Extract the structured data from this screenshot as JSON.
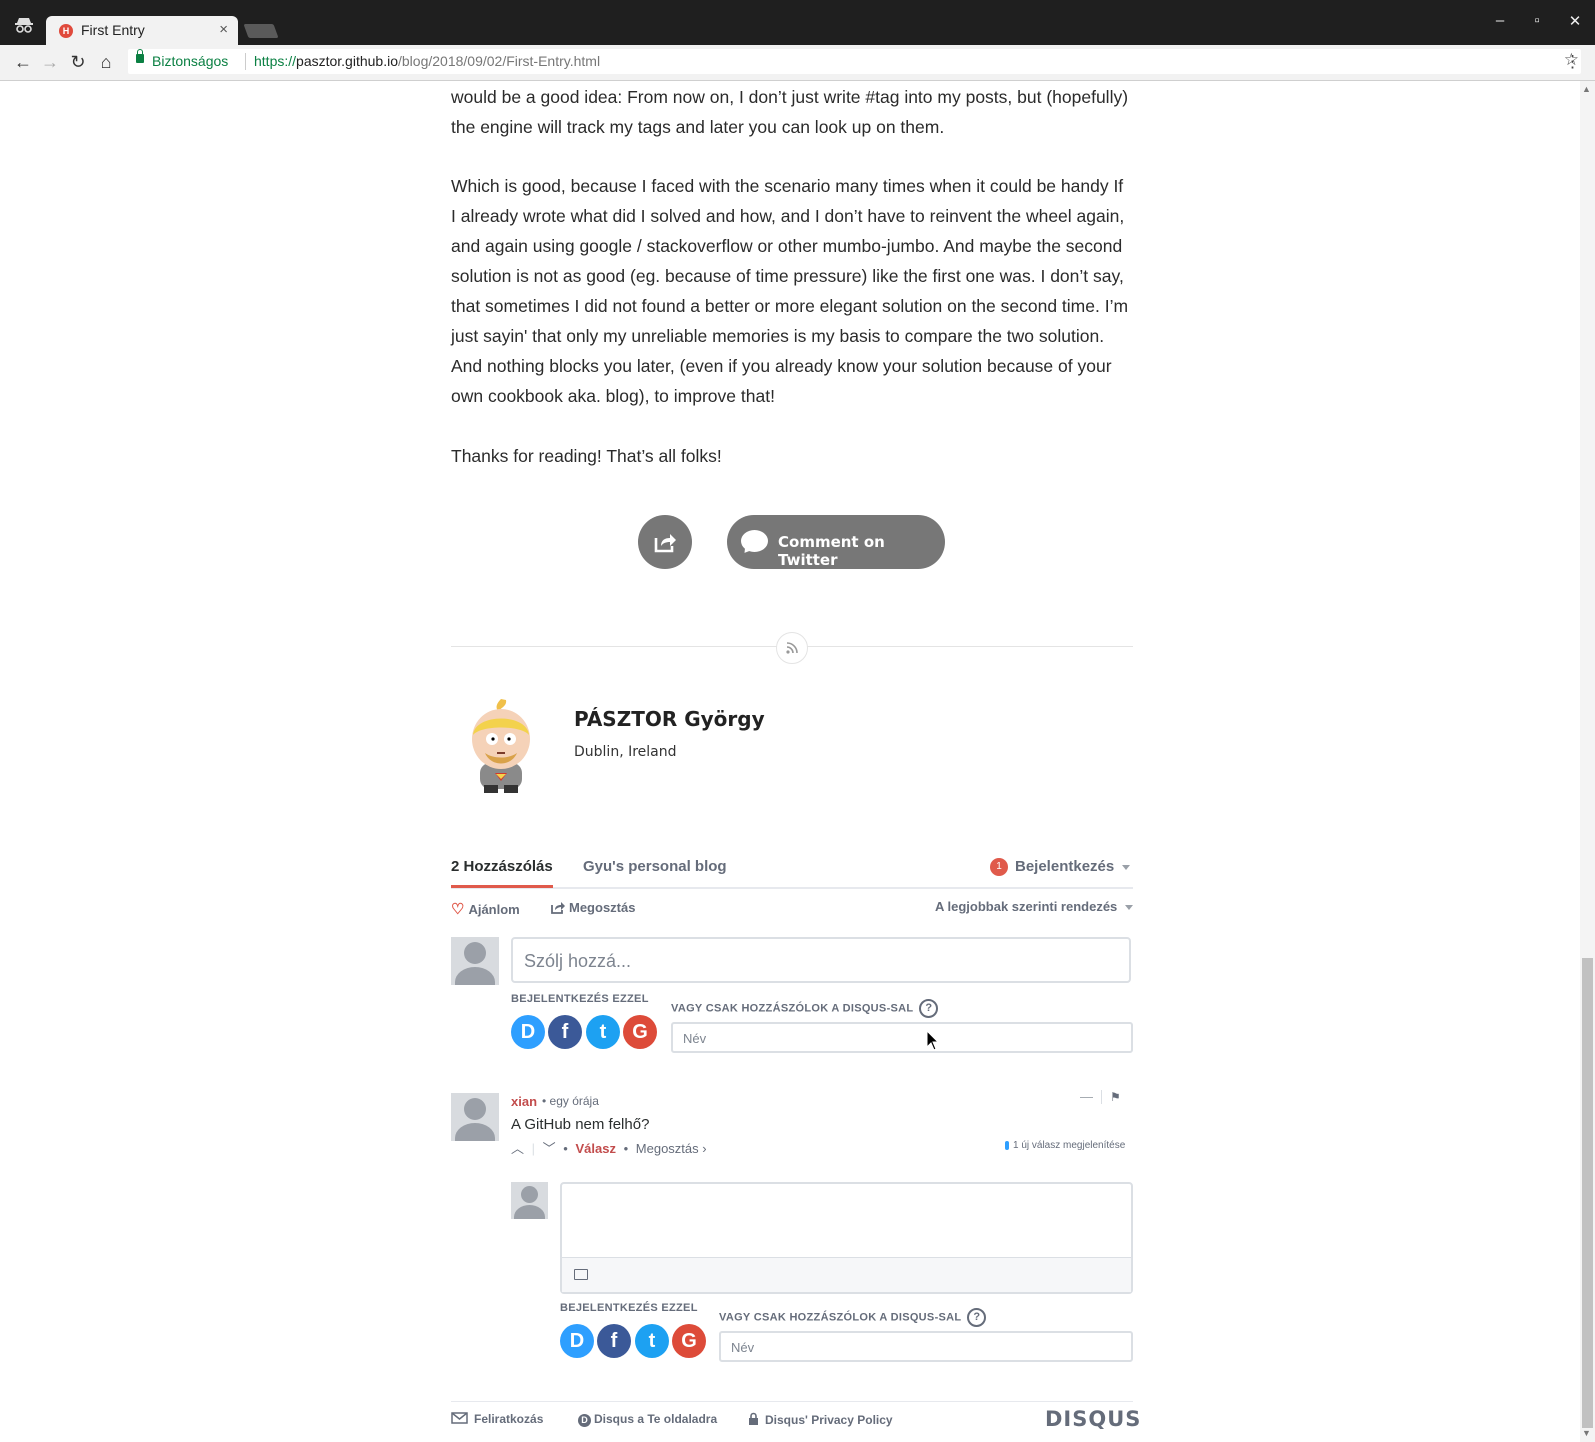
{
  "browser": {
    "tab_title": "First Entry",
    "tab_close": "×",
    "secure_label": "Biztonságos",
    "url_scheme": "https://",
    "url_host": "pasztor.github.io",
    "url_path": "/blog/2018/09/02/First-Entry.html"
  },
  "article": {
    "para1": "would be a good idea: From now on, I don’t just write #tag into my posts, but (hopefully) the engine will track my tags and later you can look up on them.",
    "para2": "Which is good, because I faced with the scenario many times when it could be handy If I already wrote what did I solved and how, and I don’t have to reinvent the wheel again, and again using google / stackoverflow or other mumbo-jumbo. And maybe the second solution is not as good (eg. because of time pressure) like the first one was. I don’t say, that sometimes I did not found a better or more elegant solution on the second time. I’m just sayin' that only my unreliable memories is my basis to compare the two solution. And nothing blocks you later, (even if you already know your solution because of your own cookbook aka. blog), to improve that!",
    "para3": "Thanks for reading! That’s all folks!",
    "twitter_label": "Comment on Twitter"
  },
  "author": {
    "name": "PÁSZTOR György",
    "location": "Dublin, Ireland"
  },
  "disqus": {
    "tab_comments": "2 Hozzászólás",
    "tab_blog": "Gyu's personal blog",
    "notif_count": "1",
    "login": "Bejelentkezés",
    "recommend": "Ajánlom",
    "share": "Megosztás",
    "sort": "A legjobbak szerinti rendezés",
    "input_placeholder": "Szólj hozzá...",
    "login_with": "BEJELENTKEZÉS EZZEL",
    "or_guest": "VAGY CSAK HOZZÁSZÓLOK A DISQUS-SAL",
    "qmark": "?",
    "name_placeholder": "Név",
    "social": {
      "d": "D",
      "f": "f",
      "t": "t",
      "g": "G"
    },
    "comment": {
      "author": "xian",
      "time": "• egy órája",
      "text": "A GitHub nem felhő?",
      "reply": "Válasz",
      "share": "Megosztás ›",
      "new_replies": "1 új válasz megjelenítése",
      "collapse": "—"
    },
    "footer": {
      "subscribe": "Feliratkozás",
      "add_disqus": "Disqus a Te oldaladra",
      "privacy": "Disqus' Privacy Policy",
      "brand": "DISQUS"
    },
    "accent": "#e05a4b",
    "link_blue": "#2e9fff"
  }
}
